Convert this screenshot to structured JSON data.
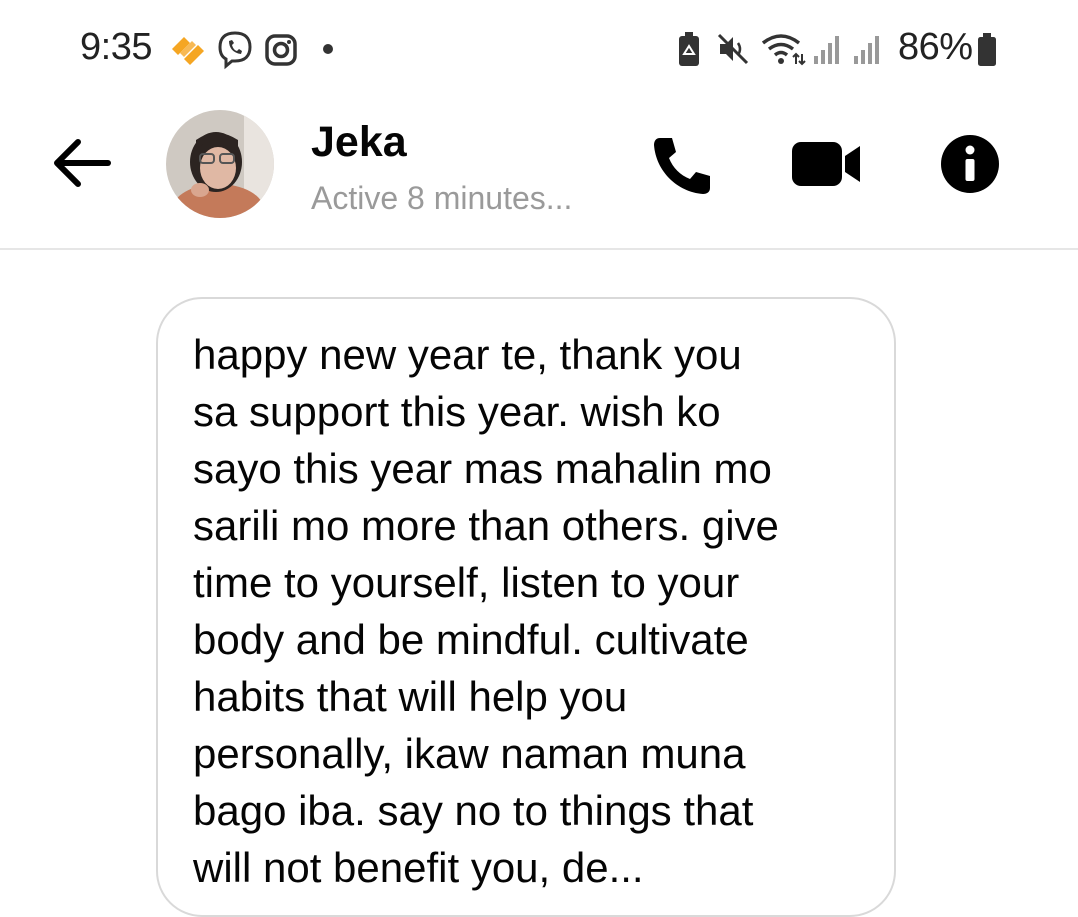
{
  "status_bar": {
    "time": "9:35",
    "battery_percent": "86%",
    "icons": [
      "swoosh-icon",
      "viber-icon",
      "instagram-icon",
      "notification-dot-icon",
      "battery-saver-icon",
      "mute-icon",
      "wifi-icon",
      "signal-icon",
      "signal-icon-2",
      "battery-icon"
    ]
  },
  "header": {
    "contact_name": "Jeka",
    "contact_status": "Active 8 minutes..."
  },
  "message": {
    "text": "happy new year te, thank you\nsa support this year. wish ko\nsayo this year mas mahalin mo\nsarili mo more than others. give\ntime to yourself, listen to your\nbody and be mindful. cultivate\nhabits that will help you\npersonally, ikaw naman muna\nbago iba. say no to things that\nwill not benefit you, de..."
  },
  "colors": {
    "accent_orange": "#f5a623",
    "muted_text": "#9a9a9a",
    "bubble_border": "#d9d9d9"
  }
}
